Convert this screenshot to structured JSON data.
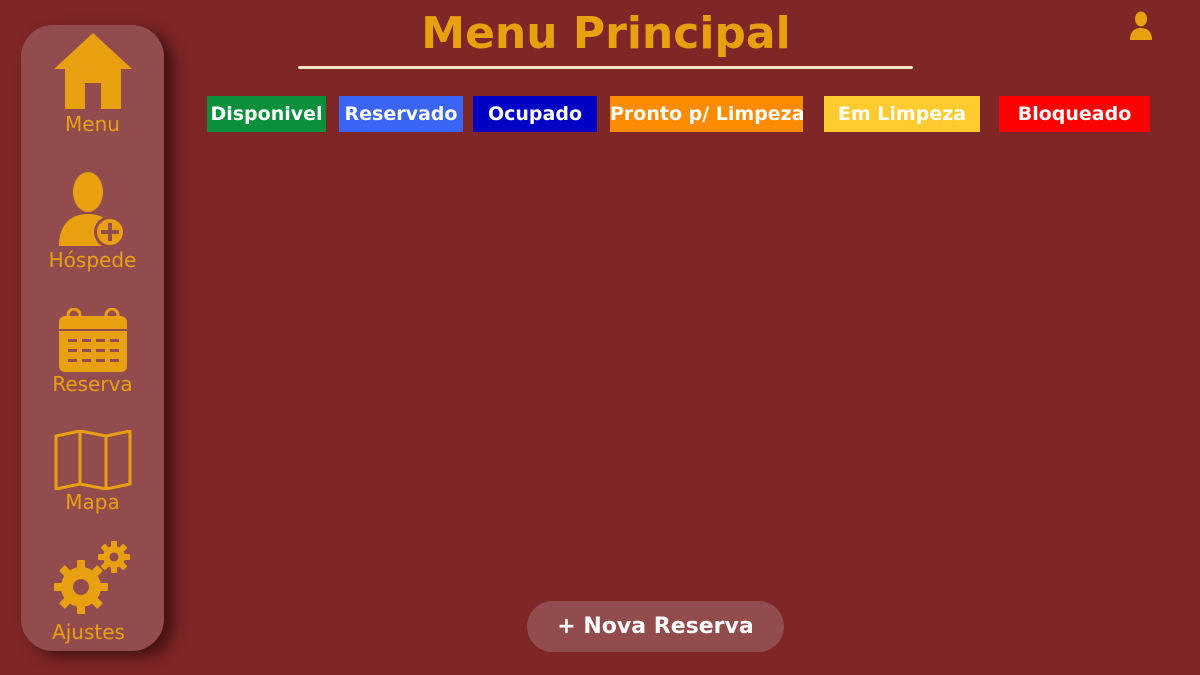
{
  "header": {
    "title": "Menu Principal"
  },
  "sidebar": {
    "items": [
      {
        "label": "Menu",
        "icon": "home-icon"
      },
      {
        "label": "Hóspede",
        "icon": "add-user-icon"
      },
      {
        "label": "Reserva",
        "icon": "calendar-icon"
      },
      {
        "label": "Mapa",
        "icon": "map-icon"
      },
      {
        "label": "Ajustes",
        "icon": "gears-icon"
      }
    ]
  },
  "status_legend": [
    {
      "label": "Disponivel",
      "color": "#0b8f3c"
    },
    {
      "label": "Reservado",
      "color": "#3b66f5"
    },
    {
      "label": "Ocupado",
      "color": "#0000c4"
    },
    {
      "label": "Pronto p/ Limpeza",
      "color": "#ff8c00"
    },
    {
      "label": "Em Limpeza",
      "color": "#ffcb2f"
    },
    {
      "label": "Bloqueado",
      "color": "#ff0000"
    }
  ],
  "actions": {
    "new_reserva_label": "+ Nova Reserva"
  },
  "colors": {
    "background": "#7f2627",
    "sidebar": "#934c4e",
    "accent": "#e8a011"
  }
}
